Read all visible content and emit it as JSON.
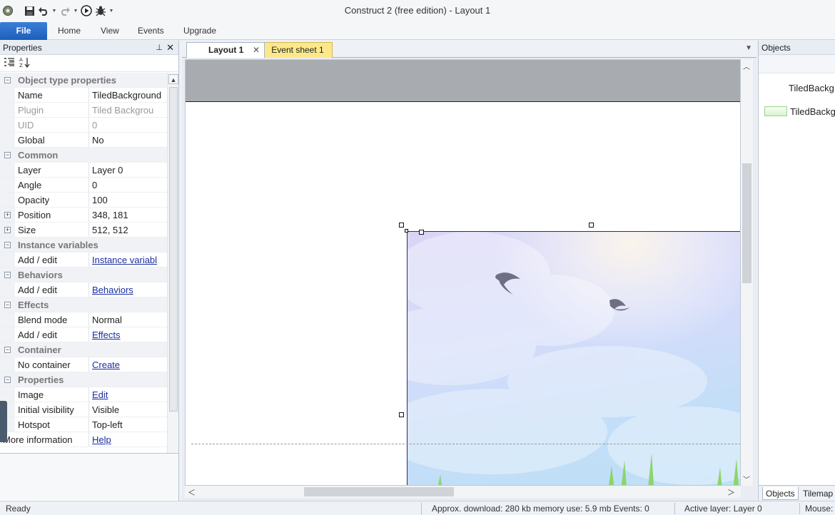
{
  "window": {
    "title": "Construct 2  (free edition) - Layout 1"
  },
  "quick_access": [
    "app-icon",
    "save-icon",
    "undo-icon",
    "redo-icon",
    "run-icon",
    "debug-icon",
    "customize-icon"
  ],
  "ribbon": {
    "file": "File",
    "tabs": [
      "Home",
      "View",
      "Events",
      "Upgrade"
    ]
  },
  "properties": {
    "title": "Properties",
    "rows": [
      {
        "kind": "cat",
        "name": "Object type properties"
      },
      {
        "kind": "prop",
        "name": "Name",
        "value": "TiledBackground"
      },
      {
        "kind": "dim",
        "name": "Plugin",
        "value": "Tiled Backgrou"
      },
      {
        "kind": "dim",
        "name": "UID",
        "value": "0"
      },
      {
        "kind": "prop",
        "name": "Global",
        "value": "No"
      },
      {
        "kind": "cat",
        "name": "Common"
      },
      {
        "kind": "prop",
        "name": "Layer",
        "value": "Layer 0"
      },
      {
        "kind": "prop",
        "name": "Angle",
        "value": "0"
      },
      {
        "kind": "prop",
        "name": "Opacity",
        "value": "100"
      },
      {
        "kind": "exp",
        "name": "Position",
        "value": "348, 181"
      },
      {
        "kind": "exp",
        "name": "Size",
        "value": "512, 512"
      },
      {
        "kind": "cat",
        "name": "Instance variables"
      },
      {
        "kind": "link",
        "name": "Add / edit",
        "value": "Instance variabl"
      },
      {
        "kind": "cat",
        "name": "Behaviors"
      },
      {
        "kind": "link",
        "name": "Add / edit",
        "value": "Behaviors"
      },
      {
        "kind": "cat",
        "name": "Effects"
      },
      {
        "kind": "prop",
        "name": "Blend mode",
        "value": "Normal"
      },
      {
        "kind": "link",
        "name": "Add / edit",
        "value": "Effects"
      },
      {
        "kind": "cat",
        "name": "Container"
      },
      {
        "kind": "link",
        "name": "No container",
        "value": "Create"
      },
      {
        "kind": "cat",
        "name": "Properties"
      },
      {
        "kind": "link",
        "name": "Image",
        "value": "Edit"
      },
      {
        "kind": "prop",
        "name": "Initial visibility",
        "value": "Visible"
      },
      {
        "kind": "prop",
        "name": "Hotspot",
        "value": "Top-left"
      },
      {
        "kind": "more",
        "name": "More information",
        "value": "Help"
      }
    ]
  },
  "document": {
    "tabs": [
      {
        "label": "Layout 1",
        "active": true
      },
      {
        "label": "Event sheet 1",
        "active": false
      }
    ]
  },
  "objects": {
    "title": "Objects",
    "items": [
      "TiledBackg",
      "TiledBackg"
    ],
    "tabs": [
      "Objects",
      "Tilemap"
    ]
  },
  "status": {
    "ready": "Ready",
    "download": "Approx. download: 280 kb  memory use: 5.9 mb  Events: 0",
    "layer": "Active layer: Layer 0",
    "mouse": "Mouse:"
  },
  "colors": {
    "file_button": "#1d5fb8",
    "event_sheet_tab": "#fbe88a",
    "layout_margin": "#a8acb1",
    "link": "#1a2ea0"
  }
}
